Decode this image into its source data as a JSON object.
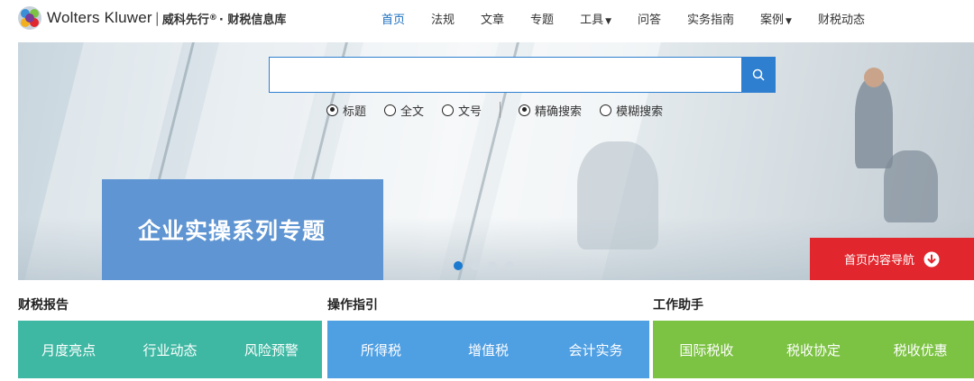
{
  "brand": {
    "name": "Wolters Kluwer",
    "separator": "|",
    "cn_name": "威科先行",
    "reg": "®",
    "product": "· 财税信息库"
  },
  "nav": [
    {
      "label": "首页",
      "active": true,
      "dropdown": false
    },
    {
      "label": "法规",
      "active": false,
      "dropdown": false
    },
    {
      "label": "文章",
      "active": false,
      "dropdown": false
    },
    {
      "label": "专题",
      "active": false,
      "dropdown": false
    },
    {
      "label": "工具",
      "active": false,
      "dropdown": true
    },
    {
      "label": "问答",
      "active": false,
      "dropdown": false
    },
    {
      "label": "实务指南",
      "active": false,
      "dropdown": false
    },
    {
      "label": "案例",
      "active": false,
      "dropdown": true
    },
    {
      "label": "财税动态",
      "active": false,
      "dropdown": false
    }
  ],
  "search": {
    "value": "",
    "placeholder": "",
    "button_icon": "search-icon",
    "scope_options": [
      {
        "label": "标题",
        "checked": true
      },
      {
        "label": "全文",
        "checked": false
      },
      {
        "label": "文号",
        "checked": false
      }
    ],
    "mode_options": [
      {
        "label": "精确搜索",
        "checked": true
      },
      {
        "label": "模糊搜索",
        "checked": false
      }
    ]
  },
  "banner": {
    "promo_title": "企业实操系列专题",
    "slide_count": 4,
    "active_slide": 1,
    "nav_button_label": "首页内容导航",
    "nav_button_icon": "arrow-down-circle-icon"
  },
  "sections": [
    {
      "title": "财税报告",
      "color": "#3fb8a3",
      "items": [
        "月度亮点",
        "行业动态",
        "风险预警"
      ]
    },
    {
      "title": "操作指引",
      "color": "#4f9fe3",
      "items": [
        "所得税",
        "增值税",
        "会计实务"
      ]
    },
    {
      "title": "工作助手",
      "color": "#7cc243",
      "items": [
        "国际税收",
        "税收协定",
        "税收优惠"
      ]
    }
  ],
  "colors": {
    "accent": "#2e7fd0",
    "nav_active": "#1a6fbf",
    "promo": "#5f95d2",
    "nav_button": "#e2262d"
  }
}
